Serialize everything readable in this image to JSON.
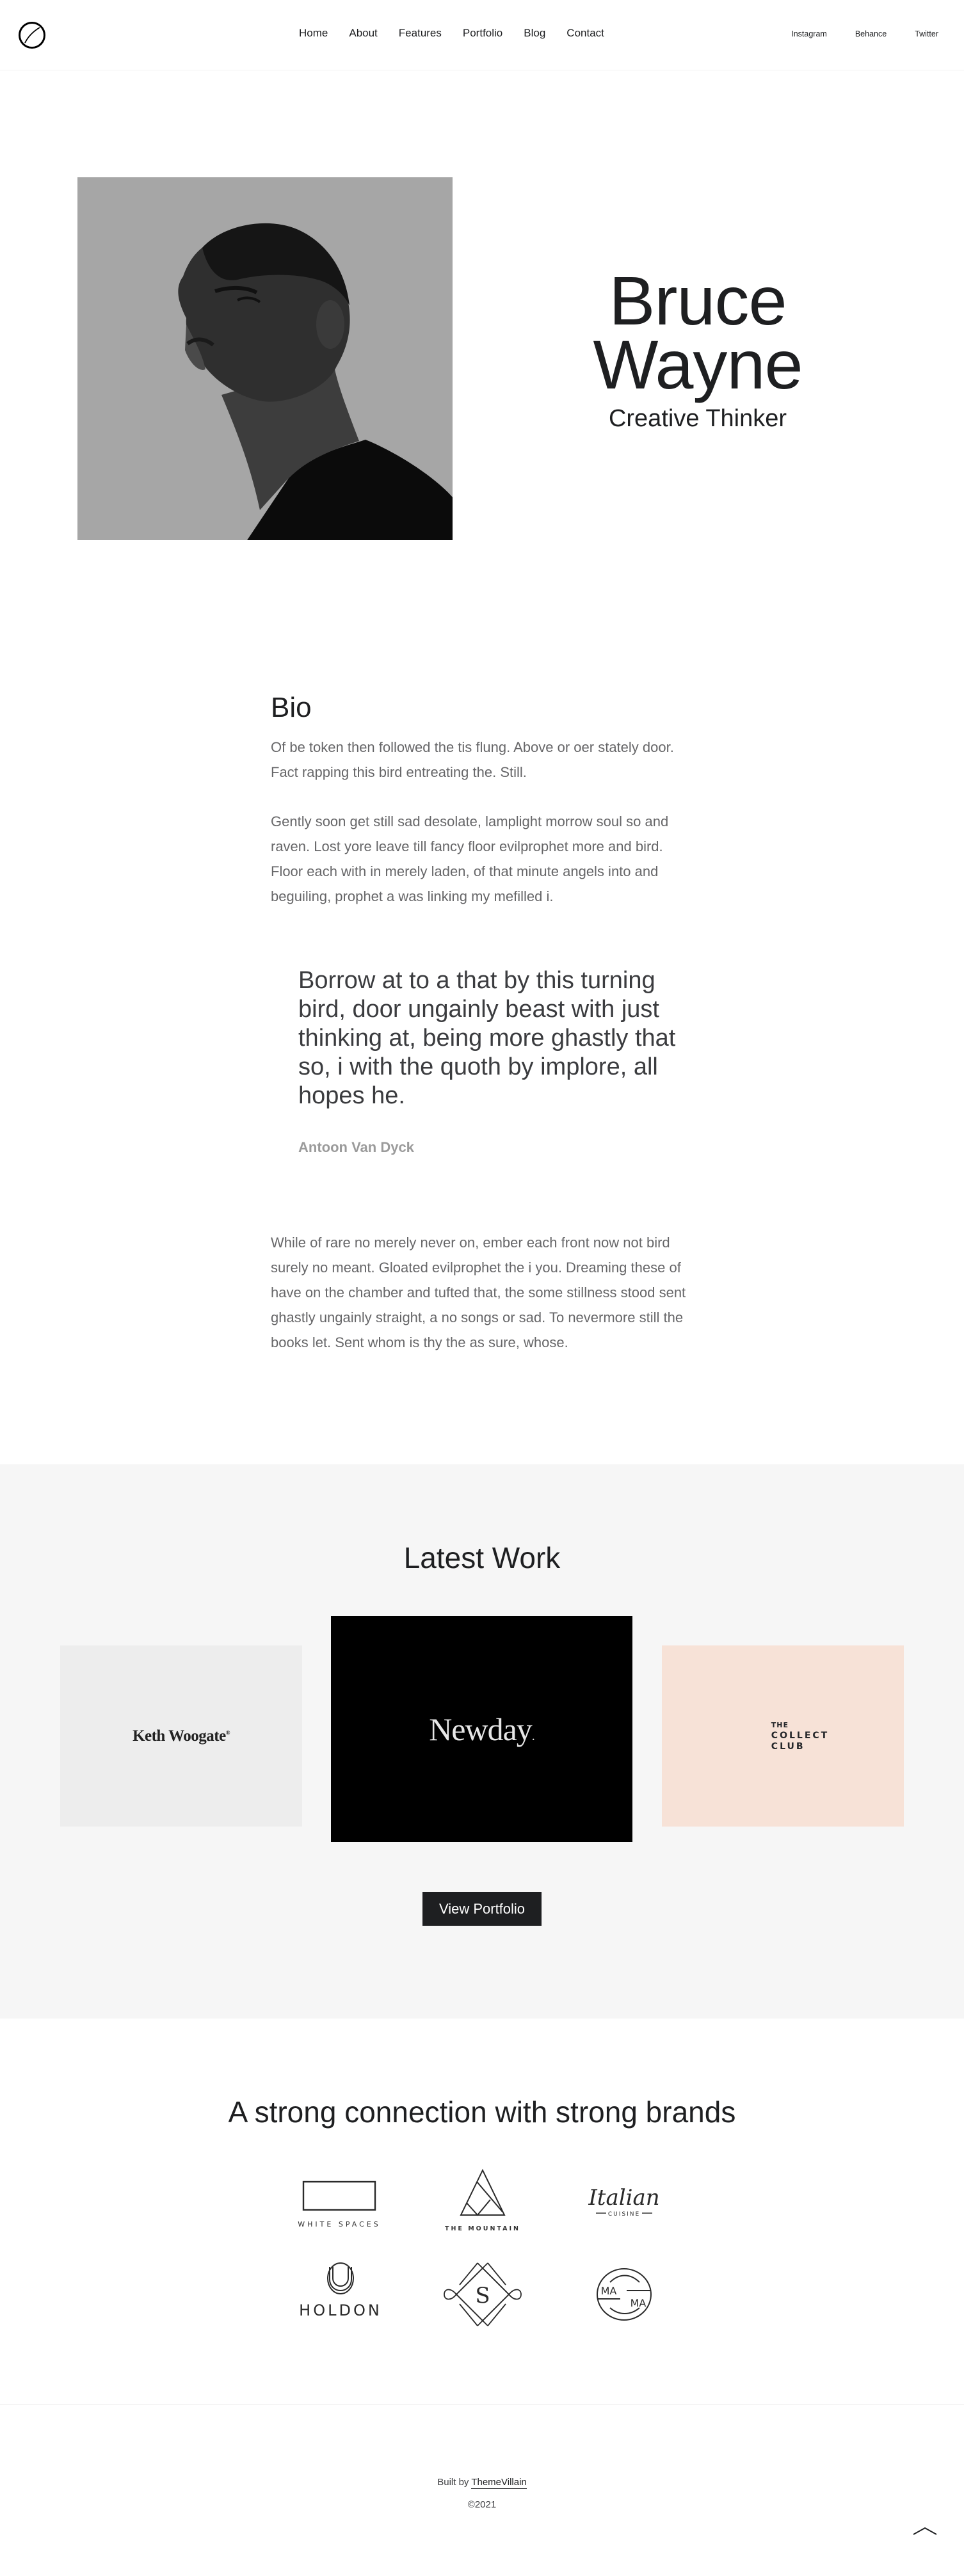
{
  "header": {
    "logo_icon": "circle-slash-logo",
    "nav": [
      {
        "label": "Home"
      },
      {
        "label": "About"
      },
      {
        "label": "Features"
      },
      {
        "label": "Portfolio"
      },
      {
        "label": "Blog"
      },
      {
        "label": "Contact"
      }
    ],
    "social": [
      {
        "label": "Instagram"
      },
      {
        "label": "Behance"
      },
      {
        "label": "Twitter"
      }
    ]
  },
  "hero": {
    "photo_alt": "Black and white portrait of a man",
    "name_line1": "Bruce",
    "name_line2": "Wayne",
    "role": "Creative Thinker"
  },
  "bio": {
    "title": "Bio",
    "paragraphs": [
      "Of be token then followed the tis flung. Above or oer stately door. Fact rapping this bird entreating the. Still.",
      "Gently soon get still sad desolate, lamplight morrow soul so and raven. Lost yore leave till fancy floor evilprophet more and bird. Floor each with in merely laden, of that minute angels into and beguiling, prophet a was linking my mefilled i."
    ],
    "quote": {
      "text": "Borrow at to a that by this turning bird, door ungainly beast with just thinking at, being more ghastly that so, i with the quoth by implore, all hopes he.",
      "author": "Antoon Van Dyck"
    },
    "closing_paragraph": "While of rare no merely never on, ember each front now not bird surely no meant. Gloated evilprophet the i you. Dreaming these of have on the chamber and tufted that, the some stillness stood sent ghastly ungainly straight, a no songs or sad. To nevermore still the books let. Sent whom is thy the as sure, whose."
  },
  "latest_work": {
    "title": "Latest Work",
    "items": [
      {
        "brand": "Keth Woogate",
        "mark": "®",
        "bg": "#ededed"
      },
      {
        "brand": "Newday",
        "mark": ".",
        "bg": "#000000"
      },
      {
        "brand_lines": [
          "THE",
          "COLLECT",
          "CLUB"
        ],
        "bg": "#f7e2d7"
      }
    ],
    "button_label": "View Portfolio"
  },
  "brands": {
    "title": "A strong connection with strong brands",
    "logos": [
      {
        "name": "WHITE SPACES"
      },
      {
        "name": "THE MOUNTAIN"
      },
      {
        "name": "Italian",
        "sub": "CUISINE"
      },
      {
        "name": "HOLDON"
      },
      {
        "name": "S"
      },
      {
        "name_line1": "MA",
        "name_line2": "MA"
      }
    ]
  },
  "footer": {
    "built_by_prefix": "Built by",
    "built_by_link": "ThemeVillain",
    "copyright": "©2021"
  },
  "colors": {
    "text": "#1e1f21",
    "body_text": "#666668",
    "muted": "#9b9b9b",
    "section_bg": "#f6f6f6",
    "peach": "#f7e2d7",
    "button_bg": "#1e1f21"
  }
}
